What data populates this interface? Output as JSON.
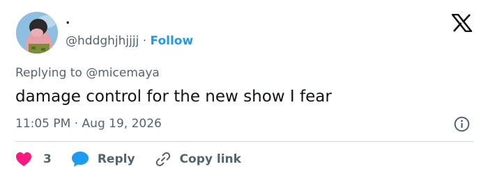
{
  "author": {
    "display_name": ".",
    "handle": "@hddghjhjjjj",
    "separator": "·",
    "follow_label": "Follow"
  },
  "reply_context": {
    "prefix": "Replying to",
    "mention": "@micemaya"
  },
  "tweet": {
    "text": "damage control for the new show I fear",
    "time": "11:05 PM",
    "separator": "·",
    "date": "Aug 19, 2026"
  },
  "actions": {
    "likes_count": "3",
    "reply_label": "Reply",
    "copy_link_label": "Copy link"
  },
  "colors": {
    "accent": "#1d9bf0",
    "like": "#f91880",
    "text_secondary": "#536471"
  }
}
